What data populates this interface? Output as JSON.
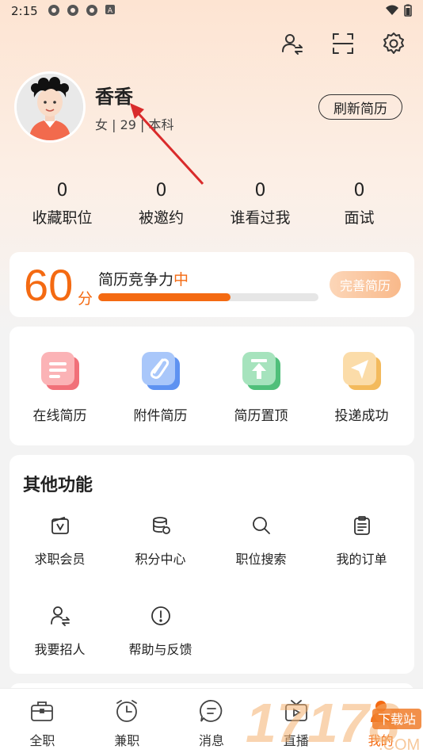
{
  "status_bar": {
    "time": "2:15"
  },
  "profile": {
    "name": "香香",
    "meta": "女 | 29 | 本科",
    "refresh_label": "刷新简历"
  },
  "stats": [
    {
      "value": "0",
      "label": "收藏职位"
    },
    {
      "value": "0",
      "label": "被邀约"
    },
    {
      "value": "0",
      "label": "谁看过我"
    },
    {
      "value": "0",
      "label": "面试"
    }
  ],
  "score": {
    "value": "60",
    "unit": "分",
    "title": "简历竞争力",
    "level": "中",
    "progress": 0.6,
    "improve_label": "完善简历"
  },
  "resume_items": [
    {
      "label": "在线简历",
      "icon": "online-resume-icon",
      "color": "#f0606a"
    },
    {
      "label": "附件简历",
      "icon": "attachment-resume-icon",
      "color": "#4c86f0"
    },
    {
      "label": "简历置顶",
      "icon": "resume-top-icon",
      "color": "#3cb86c"
    },
    {
      "label": "投递成功",
      "icon": "delivery-success-icon",
      "color": "#f2b24a"
    }
  ],
  "other": {
    "title": "其他功能",
    "items": [
      {
        "label": "求职会员",
        "icon": "vip-icon"
      },
      {
        "label": "积分中心",
        "icon": "points-icon"
      },
      {
        "label": "职位搜索",
        "icon": "search-icon"
      },
      {
        "label": "我的订单",
        "icon": "orders-icon"
      },
      {
        "label": "我要招人",
        "icon": "recruit-icon"
      },
      {
        "label": "帮助与反馈",
        "icon": "help-icon"
      }
    ]
  },
  "bottom_nav": [
    {
      "label": "全职",
      "icon": "briefcase-icon"
    },
    {
      "label": "兼职",
      "icon": "clock-icon"
    },
    {
      "label": "消息",
      "icon": "message-icon"
    },
    {
      "label": "直播",
      "icon": "tv-icon"
    },
    {
      "label": "我的",
      "icon": "profile-icon",
      "active": true
    }
  ],
  "colors": {
    "accent": "#f46a12",
    "track": "#e6e6e6"
  },
  "watermark": {
    "text": "17178",
    "sub": "下载站",
    "domain": ".COM"
  }
}
